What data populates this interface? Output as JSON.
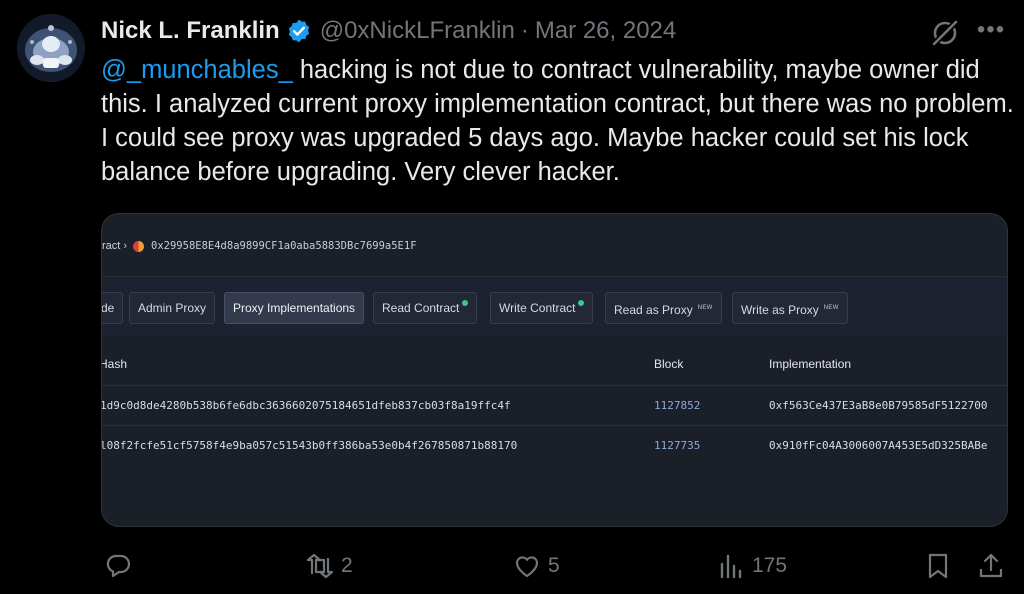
{
  "author": {
    "name": "Nick L. Franklin",
    "handle": "@0xNickLFranklin",
    "separator": "·",
    "date": "Mar 26, 2024"
  },
  "tweet": {
    "mention": "@_munchables_",
    "text": " hacking is not due to contract vulnerability, maybe owner did this. I analyzed current proxy implementation contract, but there was no problem. I could see proxy was upgraded 5 days ago. Maybe hacker could set his lock balance before upgrading. Very clever hacker."
  },
  "screenshot": {
    "breadcrumb_prefix": "ract",
    "breadcrumb_separator": "›",
    "contract_address": "0x29958E8E4d8a9899CF1a0aba5883DBc7699a5E1F",
    "tabs": [
      {
        "label": "de",
        "active": false,
        "badge": ""
      },
      {
        "label": "Admin Proxy",
        "active": false,
        "badge": ""
      },
      {
        "label": "Proxy Implementations",
        "active": true,
        "badge": ""
      },
      {
        "label": "Read Contract",
        "active": false,
        "badge": "verified"
      },
      {
        "label": "Write Contract",
        "active": false,
        "badge": "verified"
      },
      {
        "label": "Read as Proxy",
        "active": false,
        "badge": "NEW"
      },
      {
        "label": "Write as Proxy",
        "active": false,
        "badge": "NEW"
      }
    ],
    "columns": [
      "Hash",
      "Block",
      "Implementation"
    ],
    "rows": [
      {
        "hash": "1d9c0d8de4280b538b6fe6dbc3636602075184651dfeb837cb03f8a19ffc4f",
        "block": "1127852",
        "implementation": "0xf563Ce437E3aB8e0B79585dF5122700"
      },
      {
        "hash": "l08f2fcfe51cf5758f4e9ba057c51543b0ff386ba53e0b4f267850871b88170",
        "block": "1127735",
        "implementation": "0x910fFc04A3006007A453E5dD325BABe"
      }
    ]
  },
  "actions": {
    "reply_count": "",
    "retweet_count": "2",
    "like_count": "5",
    "view_count": "175"
  },
  "colors": {
    "background": "#000000",
    "link": "#1d9bf0",
    "muted": "#71767b",
    "verified": "#1d9bf0"
  }
}
